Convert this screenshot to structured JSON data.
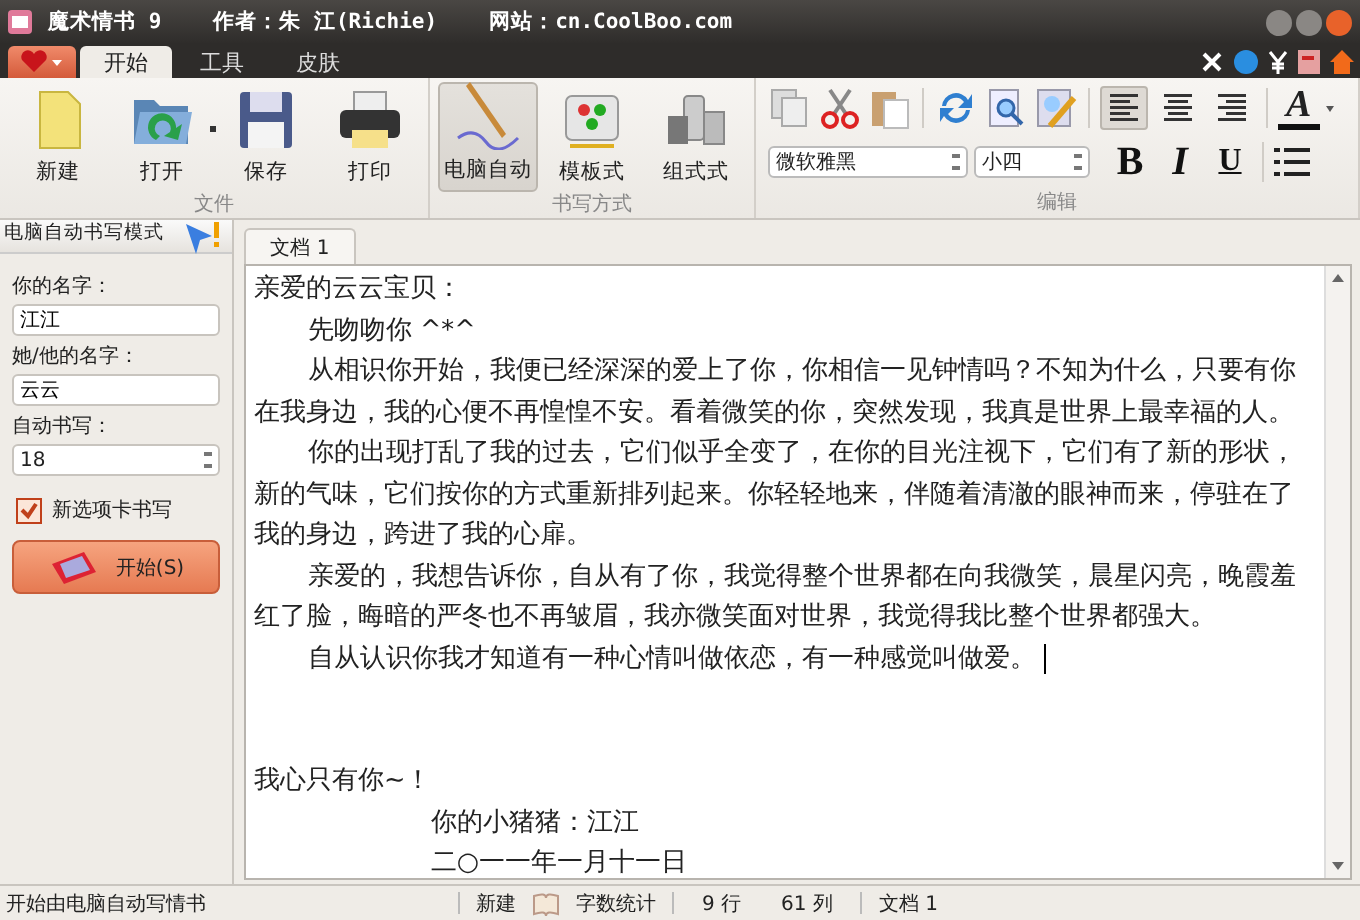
{
  "window": {
    "title": "魔术情书 9",
    "author": "作者：朱 江(Richie)",
    "website": "网站：cn.CoolBoo.com"
  },
  "tabs": [
    {
      "label": "开始",
      "selected": true
    },
    {
      "label": "工具",
      "selected": false
    },
    {
      "label": "皮肤",
      "selected": false
    }
  ],
  "ribbon": {
    "groups": [
      {
        "label": "文件",
        "buttons": [
          {
            "label": "新建",
            "kind": "new",
            "selected": false
          },
          {
            "label": "打开",
            "kind": "open",
            "selected": false
          },
          {
            "label": "保存",
            "kind": "save",
            "selected": false
          },
          {
            "label": "打印",
            "kind": "print",
            "selected": false
          }
        ]
      },
      {
        "label": "书写方式",
        "buttons": [
          {
            "label": "电脑自动",
            "kind": "pen",
            "selected": true
          },
          {
            "label": "模板式",
            "kind": "template",
            "selected": false
          },
          {
            "label": "组式式",
            "kind": "bottles",
            "selected": false
          }
        ]
      }
    ],
    "edit": {
      "label": "编辑",
      "font": "微软雅黑",
      "size": "小四",
      "bold": "B",
      "italic": "I",
      "underline": "U",
      "font_color": "A",
      "align": [
        {
          "kind": "left",
          "selected": true
        },
        {
          "kind": "center",
          "selected": false
        },
        {
          "kind": "right",
          "selected": false
        }
      ]
    }
  },
  "left_panel": {
    "title": "电脑自动书写模式",
    "fields": [
      {
        "label": "你的名字：",
        "value": "江江"
      },
      {
        "label": "她/他的名字：",
        "value": "云云"
      }
    ],
    "spinner": {
      "label": "自动书写：",
      "value": "18"
    },
    "checkbox": {
      "label": "新选项卡书写",
      "checked": true
    },
    "start_button": "开始(S)"
  },
  "document": {
    "tab": "文档 1",
    "lines": [
      {
        "kind": "plain",
        "text": "亲爱的云云宝贝："
      },
      {
        "kind": "indent",
        "text": "先吻吻你 ^*^"
      },
      {
        "kind": "indent",
        "text": "从相识你开始，我便已经深深的爱上了你，你相信一见钟情吗？不知为什么，只要有你在我身边，我的心便不再惶惶不安。看着微笑的你，突然发现，我真是世界上最幸福的人。"
      },
      {
        "kind": "indent",
        "text": "你的出现打乱了我的过去，它们似乎全变了，在你的目光注视下，它们有了新的形状，新的气味，它们按你的方式重新排列起来。你轻轻地来，伴随着清澈的眼神而来，停驻在了我的身边，跨进了我的心扉。"
      },
      {
        "kind": "indent",
        "text": "亲爱的，我想告诉你，自从有了你，我觉得整个世界都在向我微笑，晨星闪亮，晚霞羞红了脸，晦暗的严冬也不再皱眉，我亦微笑面对世界，我觉得我比整个世界都强大。"
      },
      {
        "kind": "indent",
        "text": "自从认识你我才知道有一种心情叫做依恋，有一种感觉叫做爱。",
        "caret": true
      },
      {
        "kind": "blank"
      },
      {
        "kind": "blank"
      },
      {
        "kind": "plain",
        "text": "我心只有你~！"
      },
      {
        "kind": "signature",
        "text": "你的小猪猪：江江"
      },
      {
        "kind": "signature",
        "text": "二○一一年一月十一日"
      }
    ]
  },
  "status_bar": {
    "message": "开始由电脑自动写情书",
    "new": "新建",
    "word_count": "字数统计",
    "row": "9 行",
    "col": "61 列",
    "doc": "文档 1"
  }
}
